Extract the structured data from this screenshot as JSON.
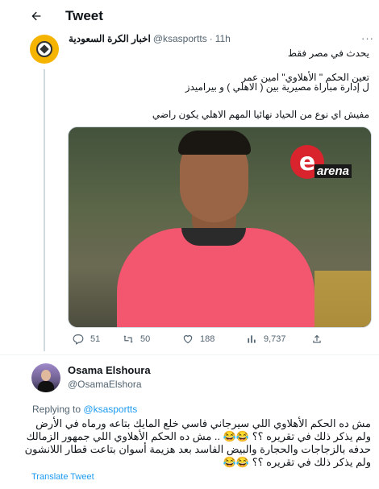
{
  "header": {
    "title": "Tweet",
    "back_icon": "arrow-left-icon"
  },
  "tweet": {
    "author_name": "اخبار الكرة السعودية",
    "handle": "@ksasportts",
    "separator": "·",
    "time": "11h",
    "more_icon": "···",
    "lines": [
      "يحدث في مصر فقط",
      "تعين الحكم \" الأهلاوي\" امين عمر",
      "ل إدارة مباراة مصيرية بين ( الاهلي ) و بيراميدز",
      "مفيش اي نوع من الحياد نهائيا المهم الاهلي يكون راضي"
    ],
    "media_logo": {
      "letter": "e",
      "text": "arena"
    },
    "actions": {
      "reply_count": "51",
      "retweet_count": "50",
      "like_count": "188",
      "view_count": "9,737"
    }
  },
  "reply": {
    "author_name": "Osama Elshoura",
    "handle": "@OsamaElshora",
    "replying_prefix": "Replying to",
    "replying_to": "@ksasportts",
    "text": "مش ده الحكم الأهلاوي اللي سيرجاني فاسي خلع المايك بتاعه ورماه في الأرض ولم يذكر ذلك في تقريره ؟؟ 😂😂 .. مش ده الحكم الأهلاوي اللي جمهور الزمالك حدفه بالزجاجات والحجارة والبيض الفاسد بعد هزيمة أسوان بتاعت قطار اللانشون ولم يذكر ذلك في تقريره ؟؟ 😂😂",
    "translate_label": "Translate Tweet"
  },
  "colors": {
    "accent": "#1d9bf0",
    "muted": "#536471",
    "text": "#0f1419"
  }
}
